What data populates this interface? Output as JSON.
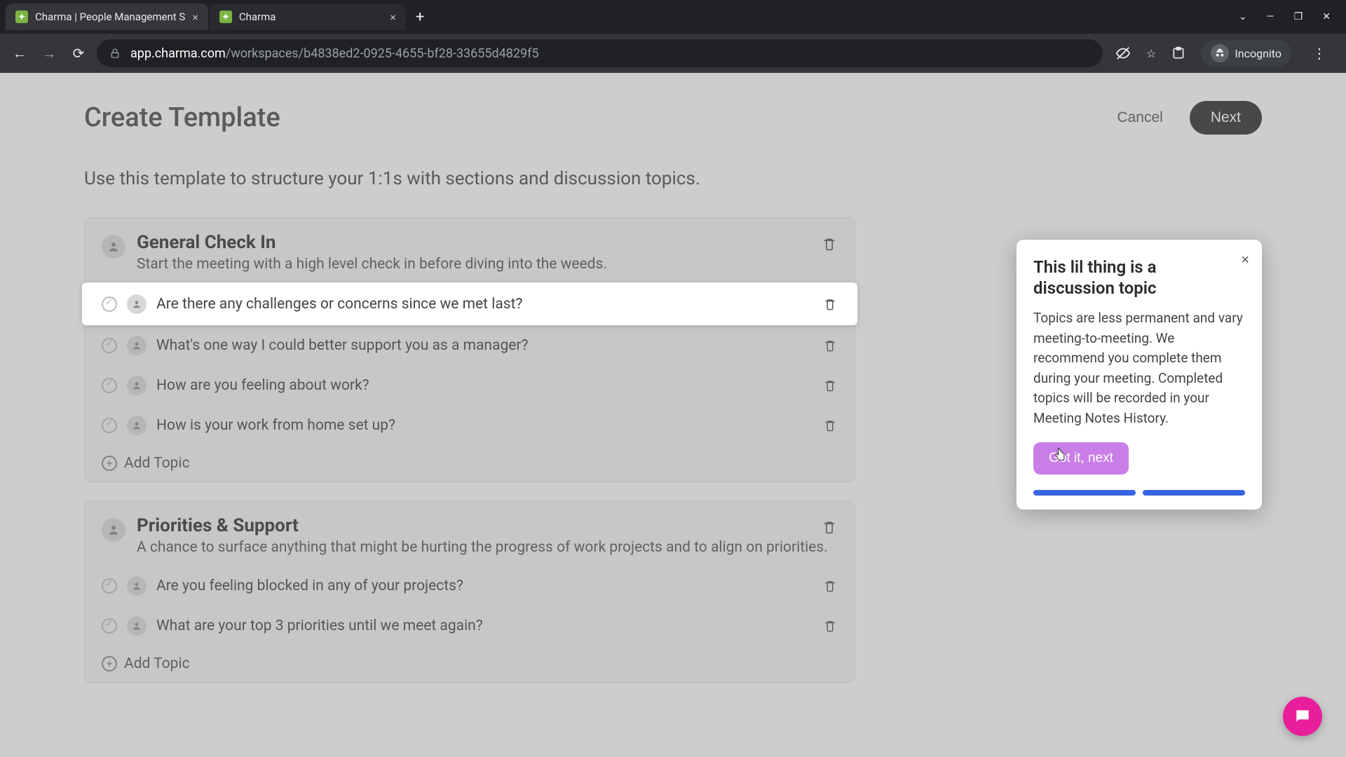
{
  "browser": {
    "tabs": [
      {
        "title": "Charma | People Management S"
      },
      {
        "title": "Charma"
      }
    ],
    "url_domain": "app.charma.com",
    "url_path": "/workspaces/b4838ed2-0925-4655-bf28-33655d4829f5",
    "incognito_label": "Incognito"
  },
  "header": {
    "title": "Create Template",
    "cancel": "Cancel",
    "next": "Next"
  },
  "subtitle": "Use this template to structure your 1:1s with sections and discussion topics.",
  "sections": [
    {
      "title": "General Check In",
      "desc": "Start the meeting with a high level check in before diving into the weeds.",
      "topics": [
        "Are there any challenges or concerns since we met last?",
        "What's one way I could better support you as a manager?",
        "How are you feeling about work?",
        "How is your work from home set up?"
      ],
      "add": "Add Topic"
    },
    {
      "title": "Priorities & Support",
      "desc": "A chance to surface anything that might be hurting the progress of work projects and to align on priorities.",
      "topics": [
        "Are you feeling blocked in any of your projects?",
        "What are your top 3 priorities until we meet again?"
      ],
      "add": "Add Topic"
    }
  ],
  "popover": {
    "title": "This lil thing is a discussion topic",
    "body": "Topics are less permanent and vary meeting-to-meeting. We recommend you complete them during your meeting. Completed topics will be recorded in your Meeting Notes History.",
    "button": "Got it, next"
  }
}
